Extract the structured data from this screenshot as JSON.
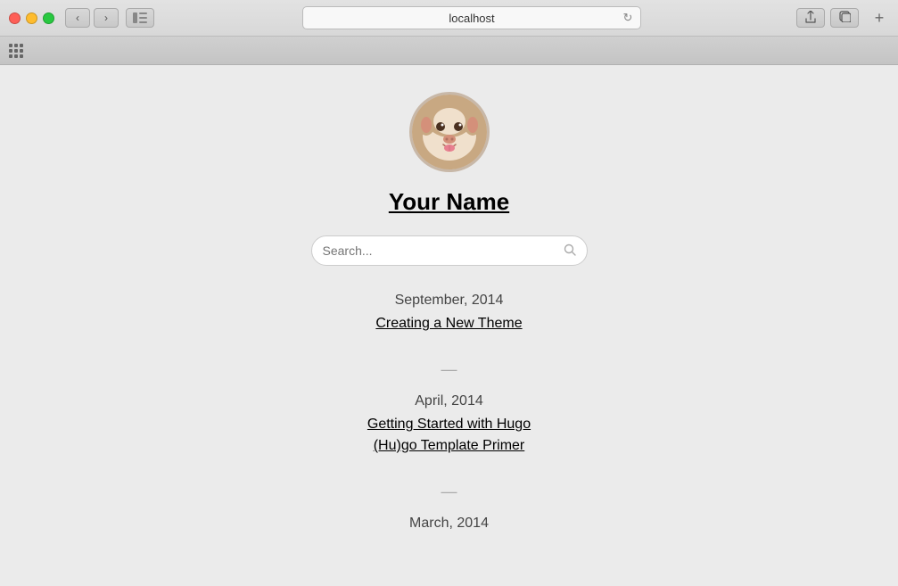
{
  "browser": {
    "url": "localhost",
    "back_icon": "‹",
    "forward_icon": "›",
    "reload_icon": "↻",
    "sidebar_icon": "▣",
    "share_icon": "⬆",
    "tabs_icon": "⧉",
    "add_tab": "+",
    "apps_label": "apps"
  },
  "site": {
    "avatar_emoji": "🐶",
    "title": "Your Name",
    "search_placeholder": "Search...",
    "search_label": "Search"
  },
  "posts": [
    {
      "date": "September, 2014",
      "items": [
        {
          "title": "Creating a New Theme",
          "link": "#"
        }
      ]
    },
    {
      "date": "April, 2014",
      "items": [
        {
          "title": "Getting Started with Hugo",
          "link": "#"
        },
        {
          "title": "(Hu)go Template Primer",
          "link": "#"
        }
      ]
    },
    {
      "date": "March, 2014",
      "items": []
    }
  ]
}
